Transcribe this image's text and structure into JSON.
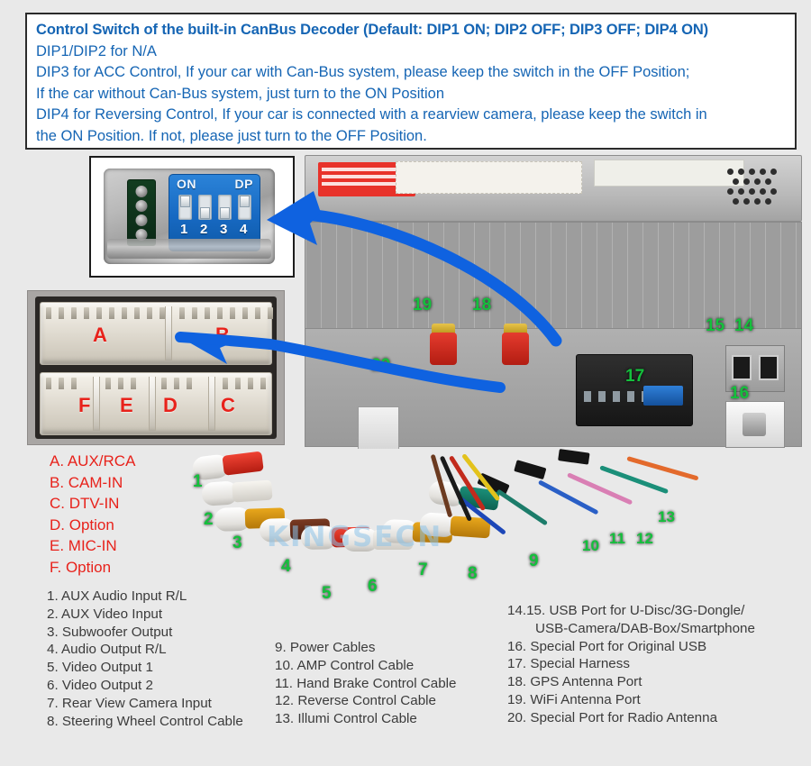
{
  "note": {
    "lines": [
      "Control Switch of the built-in CanBus Decoder (Default: DIP1 ON; DIP2 OFF; DIP3 OFF; DIP4 ON)",
      "DIP1/DIP2 for N/A",
      "DIP3 for ACC Control, If your car with Can-Bus system, please keep the switch in the OFF Position;",
      "If the car without Can-Bus system, just turn to the ON Position",
      "DIP4 for Reversing Control, If your car is connected with a rearview camera, please keep the switch in",
      "the ON Position. If not, please just turn to the OFF Position."
    ]
  },
  "dip_switch": {
    "on_label": "ON",
    "dp_label": "DP",
    "switch_numbers": [
      "1",
      "2",
      "3",
      "4"
    ],
    "switch_states": [
      "up",
      "down",
      "down",
      "up"
    ]
  },
  "connector_block": {
    "top_row_letters": [
      "A",
      "B"
    ],
    "bottom_row_letters": [
      "F",
      "E",
      "D",
      "C"
    ]
  },
  "letter_legend": [
    "A. AUX/RCA",
    "B. CAM-IN",
    "C. DTV-IN",
    "D. Option",
    "E. MIC-IN",
    "F. Option"
  ],
  "list_column_1": [
    "1. AUX Audio Input R/L",
    "2. AUX Video Input",
    "3. Subwoofer Output",
    "4. Audio Output R/L",
    "5. Video Output 1",
    "6. Video Output 2",
    "7. Rear View Camera Input",
    "8. Steering Wheel Control Cable"
  ],
  "list_column_2": [
    "9. Power Cables",
    "10. AMP Control Cable",
    "11. Hand Brake Control Cable",
    "12. Reverse Control Cable",
    "13. Illumi Control Cable"
  ],
  "list_column_3": [
    "14.15. USB Port for U-Disc/3G-Dongle/",
    "USB-Camera/DAB-Box/Smartphone",
    "16. Special Port for Original USB",
    "17. Special Harness",
    "18. GPS Antenna Port",
    "19. WiFi Antenna Port",
    "20. Special Port for Radio Antenna"
  ],
  "callouts": {
    "cable_numbers": [
      "1",
      "2",
      "3",
      "4",
      "5",
      "6",
      "7",
      "8",
      "9",
      "10",
      "11",
      "12",
      "13"
    ],
    "device_numbers": [
      "14",
      "15",
      "16",
      "17",
      "18",
      "19",
      "20"
    ]
  },
  "watermark": "KINGSECN",
  "colors": {
    "note_text": "#1565b4",
    "letter_legend_text": "#e8221b",
    "callout_green": "#14c03c",
    "arrow_blue": "#0f62e0",
    "page_background": "#e9e9e9",
    "list_text": "#3b3b3b"
  }
}
